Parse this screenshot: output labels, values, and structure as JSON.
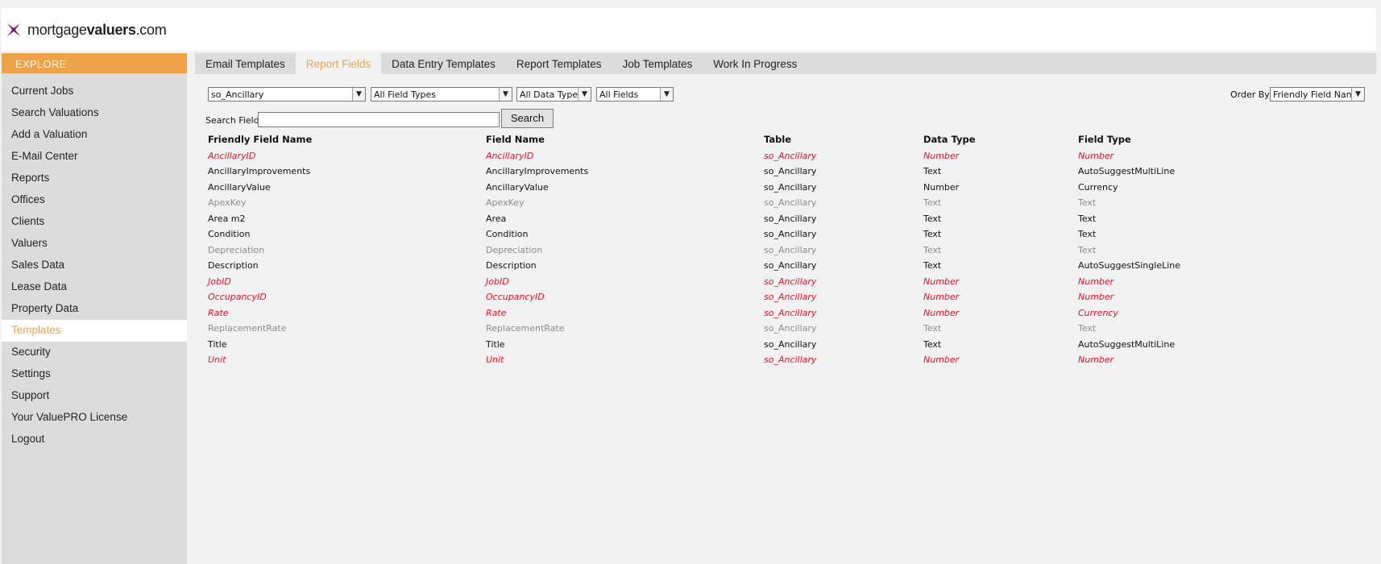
{
  "brand": {
    "name_light": "mortgage",
    "name_bold": "valuers",
    "name_tld": ".com"
  },
  "sidebar": {
    "section": "EXPLORE",
    "items": [
      {
        "label": "Current Jobs"
      },
      {
        "label": "Search Valuations"
      },
      {
        "label": "Add a Valuation"
      },
      {
        "label": "E-Mail Center"
      },
      {
        "label": "Reports"
      },
      {
        "label": "Offices"
      },
      {
        "label": "Clients"
      },
      {
        "label": "Valuers"
      },
      {
        "label": "Sales Data"
      },
      {
        "label": "Lease Data"
      },
      {
        "label": "Property Data"
      },
      {
        "label": "Templates",
        "active": true
      },
      {
        "label": "Security"
      },
      {
        "label": "Settings"
      },
      {
        "label": "Support"
      },
      {
        "label": "Your ValuePRO License"
      },
      {
        "label": "Logout"
      }
    ]
  },
  "tabs": [
    {
      "label": "Email Templates"
    },
    {
      "label": "Report Fields",
      "active": true
    },
    {
      "label": "Data Entry Templates"
    },
    {
      "label": "Report Templates"
    },
    {
      "label": "Job Templates"
    },
    {
      "label": "Work In Progress"
    }
  ],
  "filters": {
    "table": "so_Ancillary",
    "field_types": "All Field Types",
    "data_types": "All Data Types",
    "fields": "All Fields",
    "order_by_label": "Order By:",
    "order_by": "Friendly Field Name"
  },
  "search": {
    "label": "Search Field:",
    "value": "",
    "button": "Search"
  },
  "table": {
    "headers": [
      "Friendly Field Name",
      "Field Name",
      "Table",
      "Data Type",
      "Field Type"
    ],
    "rows": [
      {
        "style": "key",
        "cells": [
          "AncillaryID",
          "AncillaryID",
          "so_Ancillary",
          "Number",
          "Number"
        ]
      },
      {
        "style": "normal",
        "cells": [
          "AncillaryImprovements",
          "AncillaryImprovements",
          "so_Ancillary",
          "Text",
          "AutoSuggestMultiLine"
        ]
      },
      {
        "style": "normal",
        "cells": [
          "AncillaryValue",
          "AncillaryValue",
          "so_Ancillary",
          "Number",
          "Currency"
        ]
      },
      {
        "style": "hidden",
        "cells": [
          "ApexKey",
          "ApexKey",
          "so_Ancillary",
          "Text",
          "Text"
        ]
      },
      {
        "style": "normal",
        "cells": [
          "Area m2",
          "Area",
          "so_Ancillary",
          "Text",
          "Text"
        ]
      },
      {
        "style": "normal",
        "cells": [
          "Condition",
          "Condition",
          "so_Ancillary",
          "Text",
          "Text"
        ]
      },
      {
        "style": "hidden",
        "cells": [
          "Depreciation",
          "Depreciation",
          "so_Ancillary",
          "Text",
          "Text"
        ]
      },
      {
        "style": "normal",
        "cells": [
          "Description",
          "Description",
          "so_Ancillary",
          "Text",
          "AutoSuggestSingleLine"
        ]
      },
      {
        "style": "key",
        "cells": [
          "JobID",
          "JobID",
          "so_Ancillary",
          "Number",
          "Number"
        ]
      },
      {
        "style": "key",
        "cells": [
          "OccupancyID",
          "OccupancyID",
          "so_Ancillary",
          "Number",
          "Number"
        ]
      },
      {
        "style": "key",
        "cells": [
          "Rate",
          "Rate",
          "so_Ancillary",
          "Number",
          "Currency"
        ]
      },
      {
        "style": "hidden",
        "cells": [
          "ReplacementRate",
          "ReplacementRate",
          "so_Ancillary",
          "Text",
          "Text"
        ]
      },
      {
        "style": "normal",
        "cells": [
          "Title",
          "Title",
          "so_Ancillary",
          "Text",
          "AutoSuggestMultiLine"
        ]
      },
      {
        "style": "key",
        "cells": [
          "Unit",
          "Unit",
          "so_Ancillary",
          "Number",
          "Number"
        ]
      }
    ]
  },
  "colors": {
    "accent": "#eea34b",
    "key_field": "#e8102a",
    "hidden_field": "#8a8a8a",
    "logo_mark": "#8e1f6b"
  }
}
